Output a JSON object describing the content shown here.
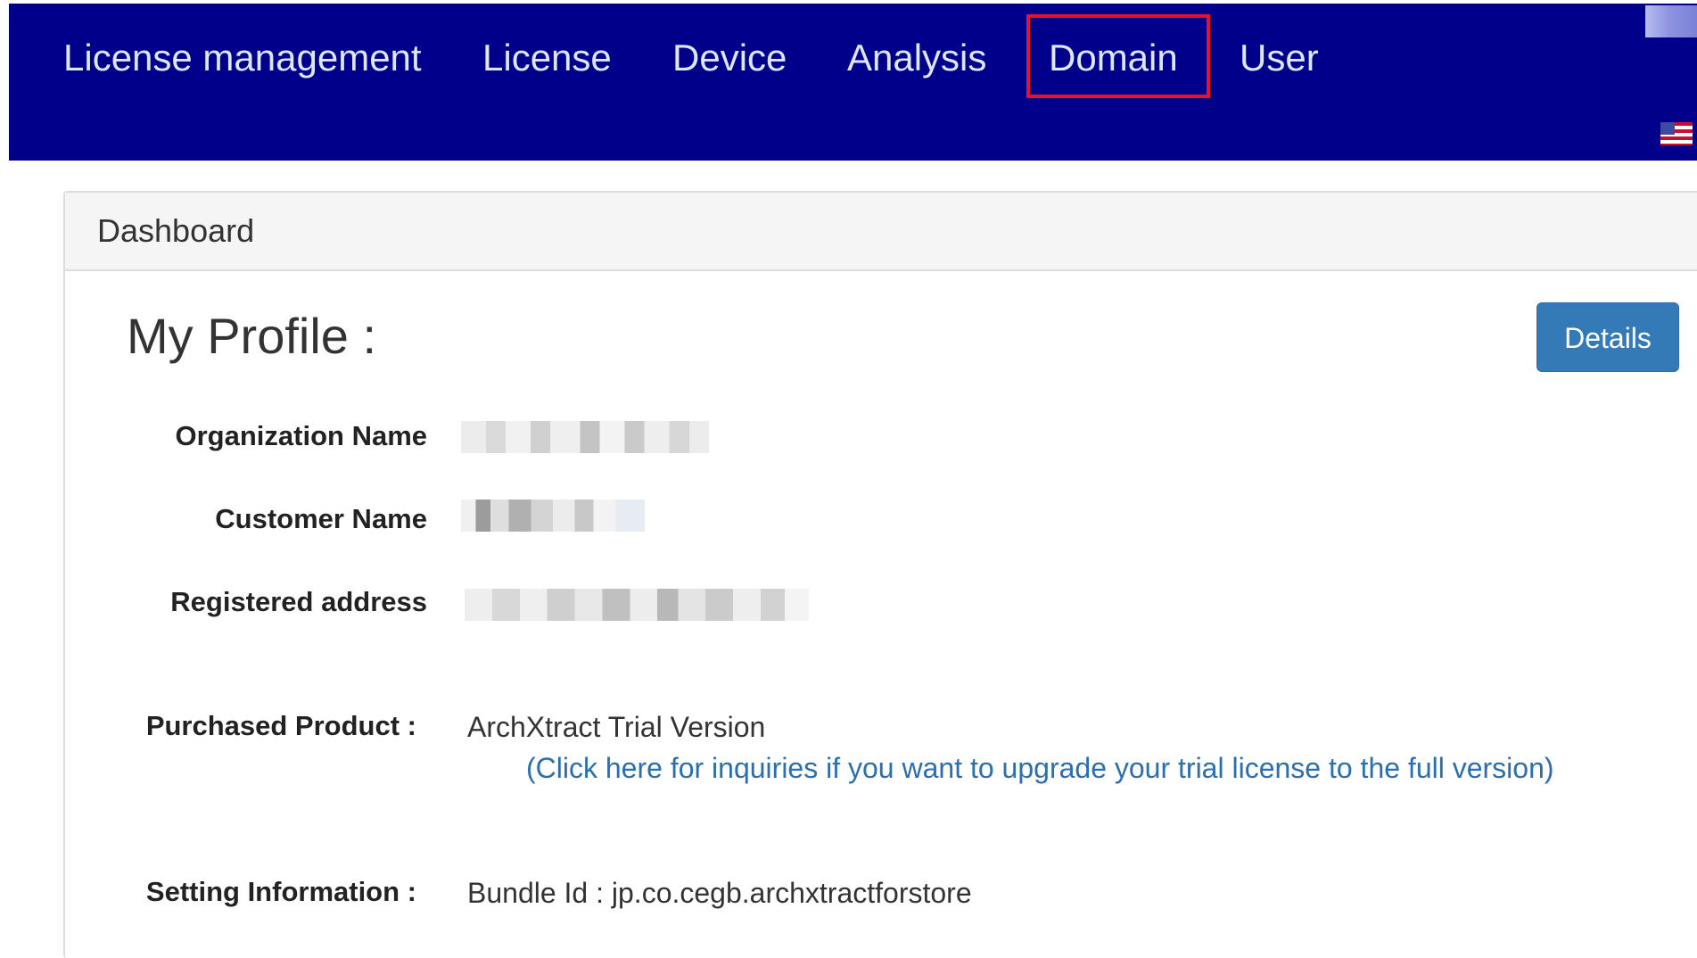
{
  "nav": {
    "items": [
      {
        "label": "License management"
      },
      {
        "label": "License"
      },
      {
        "label": "Device"
      },
      {
        "label": "Analysis"
      },
      {
        "label": "Domain",
        "highlighted": true
      },
      {
        "label": "User"
      }
    ],
    "language_icon": "us-flag-icon",
    "colors": {
      "background": "#00008b",
      "highlight_border": "#e8102a"
    }
  },
  "panel": {
    "title": "Dashboard"
  },
  "profile": {
    "title": "My Profile :",
    "details_button": "Details",
    "fields": [
      {
        "label": "Organization Name",
        "value_redacted": true
      },
      {
        "label": "Customer Name",
        "value_redacted": true
      },
      {
        "label": "Registered address",
        "value_redacted": true
      }
    ],
    "purchased_product": {
      "label": "Purchased Product :",
      "value": "ArchXtract Trial Version",
      "upgrade_link": "(Click here for inquiries if you want to upgrade your trial license to the full version)"
    },
    "setting_information": {
      "label": "Setting Information :",
      "value": "Bundle Id : jp.co.cegb.archxtractforstore"
    }
  }
}
